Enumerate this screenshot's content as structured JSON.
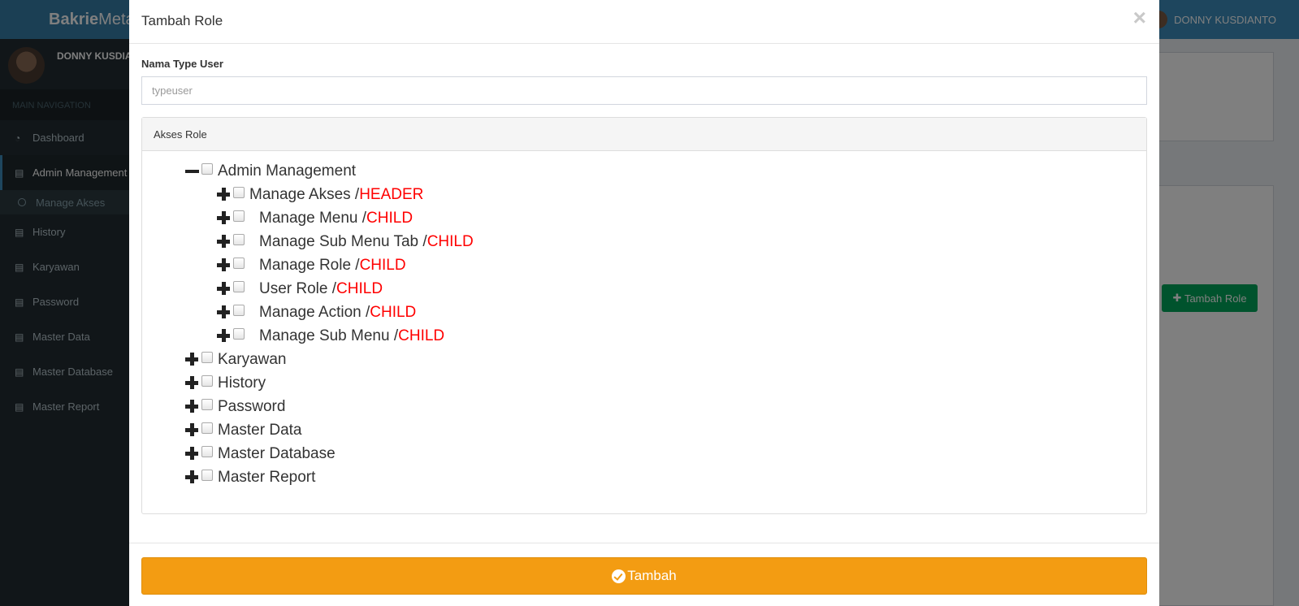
{
  "app": {
    "brand_bold": "Bakrie",
    "brand_rest": "Meta",
    "top_user": "DONNY KUSDIANTO"
  },
  "sidebar": {
    "user_name": "DONNY KUSDIA",
    "header": "MAIN NAVIGATION",
    "items": [
      {
        "label": "Dashboard",
        "icon": "dashboard-icon"
      },
      {
        "label": "Admin Management",
        "icon": "book-icon"
      },
      {
        "label": "Manage Akses",
        "icon": "circle-icon"
      },
      {
        "label": "History",
        "icon": "book-icon"
      },
      {
        "label": "Karyawan",
        "icon": "book-icon"
      },
      {
        "label": "Password",
        "icon": "book-icon"
      },
      {
        "label": "Master Data",
        "icon": "book-icon"
      },
      {
        "label": "Master Database",
        "icon": "book-icon"
      },
      {
        "label": "Master Report",
        "icon": "book-icon"
      }
    ]
  },
  "background": {
    "tambah_role_button": "Tambah Role"
  },
  "modal": {
    "title": "Tambah Role",
    "close_symbol": "×",
    "field_label": "Nama Type User",
    "field_placeholder": "typeuser",
    "field_value": "",
    "panel_title": "Akses Role",
    "submit_label": "Tambah",
    "tree": [
      {
        "name": "Admin Management",
        "tag": "",
        "state": "minus"
      },
      {
        "name": "Manage Akses / ",
        "tag": "HEADER",
        "state": "plus"
      },
      {
        "name": "Manage Menu / ",
        "tag": "CHILD",
        "state": "plus"
      },
      {
        "name": "Manage Sub Menu Tab / ",
        "tag": "CHILD",
        "state": "plus"
      },
      {
        "name": "Manage Role / ",
        "tag": "CHILD",
        "state": "plus"
      },
      {
        "name": "User Role / ",
        "tag": "CHILD",
        "state": "plus"
      },
      {
        "name": "Manage Action / ",
        "tag": "CHILD",
        "state": "plus"
      },
      {
        "name": "Manage Sub Menu / ",
        "tag": "CHILD",
        "state": "plus"
      },
      {
        "name": "Karyawan",
        "tag": "",
        "state": "plus"
      },
      {
        "name": "History",
        "tag": "",
        "state": "plus"
      },
      {
        "name": "Password",
        "tag": "",
        "state": "plus"
      },
      {
        "name": "Master Data",
        "tag": "",
        "state": "plus"
      },
      {
        "name": "Master Database",
        "tag": "",
        "state": "plus"
      },
      {
        "name": "Master Report",
        "tag": "",
        "state": "plus"
      }
    ]
  },
  "colors": {
    "accent_orange": "#f39c12",
    "tag_red": "#ff0000",
    "topbar_blue": "#3c8dbc",
    "sidebar_dark": "#222d32",
    "green_button": "#00a65a"
  }
}
